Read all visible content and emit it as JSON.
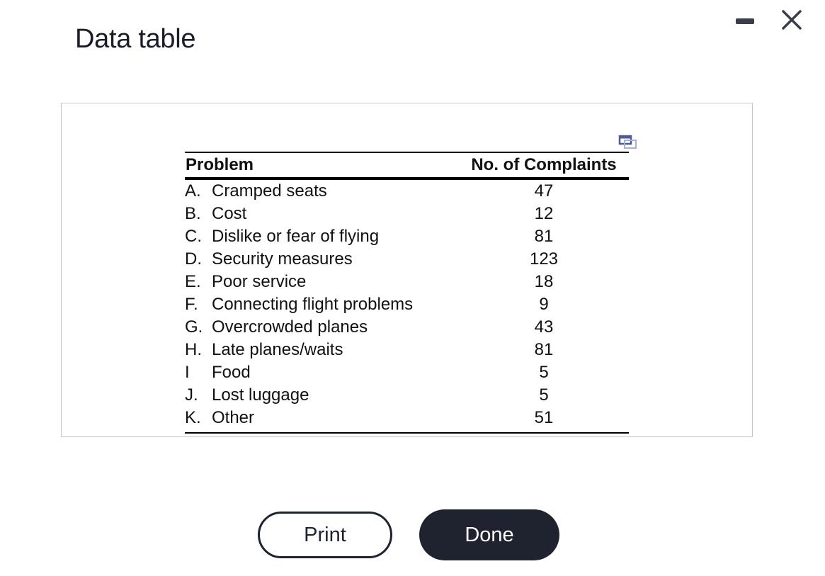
{
  "dialog": {
    "title": "Data table",
    "window_controls": {
      "minimize_icon": "minimize-icon",
      "close_icon": "close-icon"
    },
    "copy_icon": "copy-icon"
  },
  "table": {
    "headers": {
      "problem": "Problem",
      "complaints": "No. of Complaints"
    },
    "rows": [
      {
        "letter": "A.",
        "problem": "Cramped seats",
        "complaints": "47"
      },
      {
        "letter": "B.",
        "problem": "Cost",
        "complaints": "12"
      },
      {
        "letter": "C.",
        "problem": "Dislike or fear of flying",
        "complaints": "81"
      },
      {
        "letter": "D.",
        "problem": "Security measures",
        "complaints": "123"
      },
      {
        "letter": "E.",
        "problem": "Poor service",
        "complaints": "18"
      },
      {
        "letter": "F.",
        "problem": "Connecting flight problems",
        "complaints": "9"
      },
      {
        "letter": "G.",
        "problem": "Overcrowded planes",
        "complaints": "43"
      },
      {
        "letter": "H.",
        "problem": "Late planes/waits",
        "complaints": "81"
      },
      {
        "letter": "I",
        "problem": "Food",
        "complaints": "5"
      },
      {
        "letter": "J.",
        "problem": "Lost luggage",
        "complaints": "5"
      },
      {
        "letter": "K.",
        "problem": "Other",
        "complaints": "51"
      }
    ]
  },
  "buttons": {
    "print": "Print",
    "done": "Done"
  },
  "colors": {
    "dark": "#1f2330",
    "panel_border": "#c8c8c8",
    "copy_icon": "#4a5a9a"
  }
}
